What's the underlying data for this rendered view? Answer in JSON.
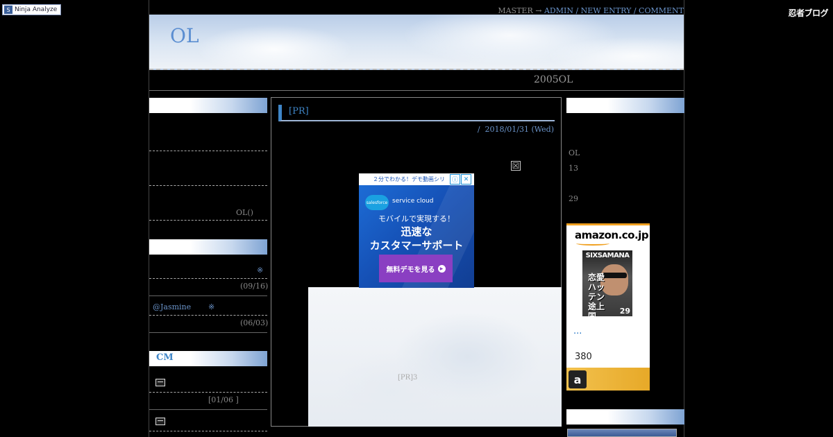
{
  "ninja_analyze": {
    "label": "Ninja Analyze"
  },
  "ninja_blog": {
    "logo": "忍者ブログ"
  },
  "topnav": {
    "master": "MASTER",
    "arrow": "→",
    "admin": "ADMIN",
    "sep1": "/",
    "new_entry": "NEW ENTRY",
    "sep2": "/",
    "comment": "COMMENT"
  },
  "header": {
    "title": "OL",
    "description": "2005OL"
  },
  "left_sidebar": {
    "section1_text": "OL()",
    "recent_comments": [
      {
        "mark": "※",
        "date": "(09/16)"
      },
      {
        "author": "@Jasmine",
        "mark": "※",
        "date": "(06/03)"
      }
    ],
    "cm_heading": "CM",
    "cm_date": "[01/06 ]"
  },
  "article": {
    "title": "[PR]",
    "meta_sep": "/",
    "date": "2018/01/31 (Wed)",
    "close": "☒",
    "pr_note": "[PR]3"
  },
  "ad": {
    "top_text": "２分でわかる！デモ動画シリ",
    "info": "ⓘ",
    "close": "✕",
    "logo": "salesforce",
    "brand": "service cloud",
    "line1": "モバイルで実現する！",
    "line2": "迅速な",
    "line3": "カスタマーサポート",
    "cta": "無料デモを見る"
  },
  "right_sidebar": {
    "profile_text1": "OL",
    "profile_text2": "13",
    "profile_text3": "29"
  },
  "amazon": {
    "logo": "amazon.co.jp",
    "cover_top": "SIXSAMANA",
    "cover_title": "恋愛ハッテン途上国",
    "cover_num": "29",
    "title": "...",
    "price": "380",
    "footer_mark": "a"
  }
}
